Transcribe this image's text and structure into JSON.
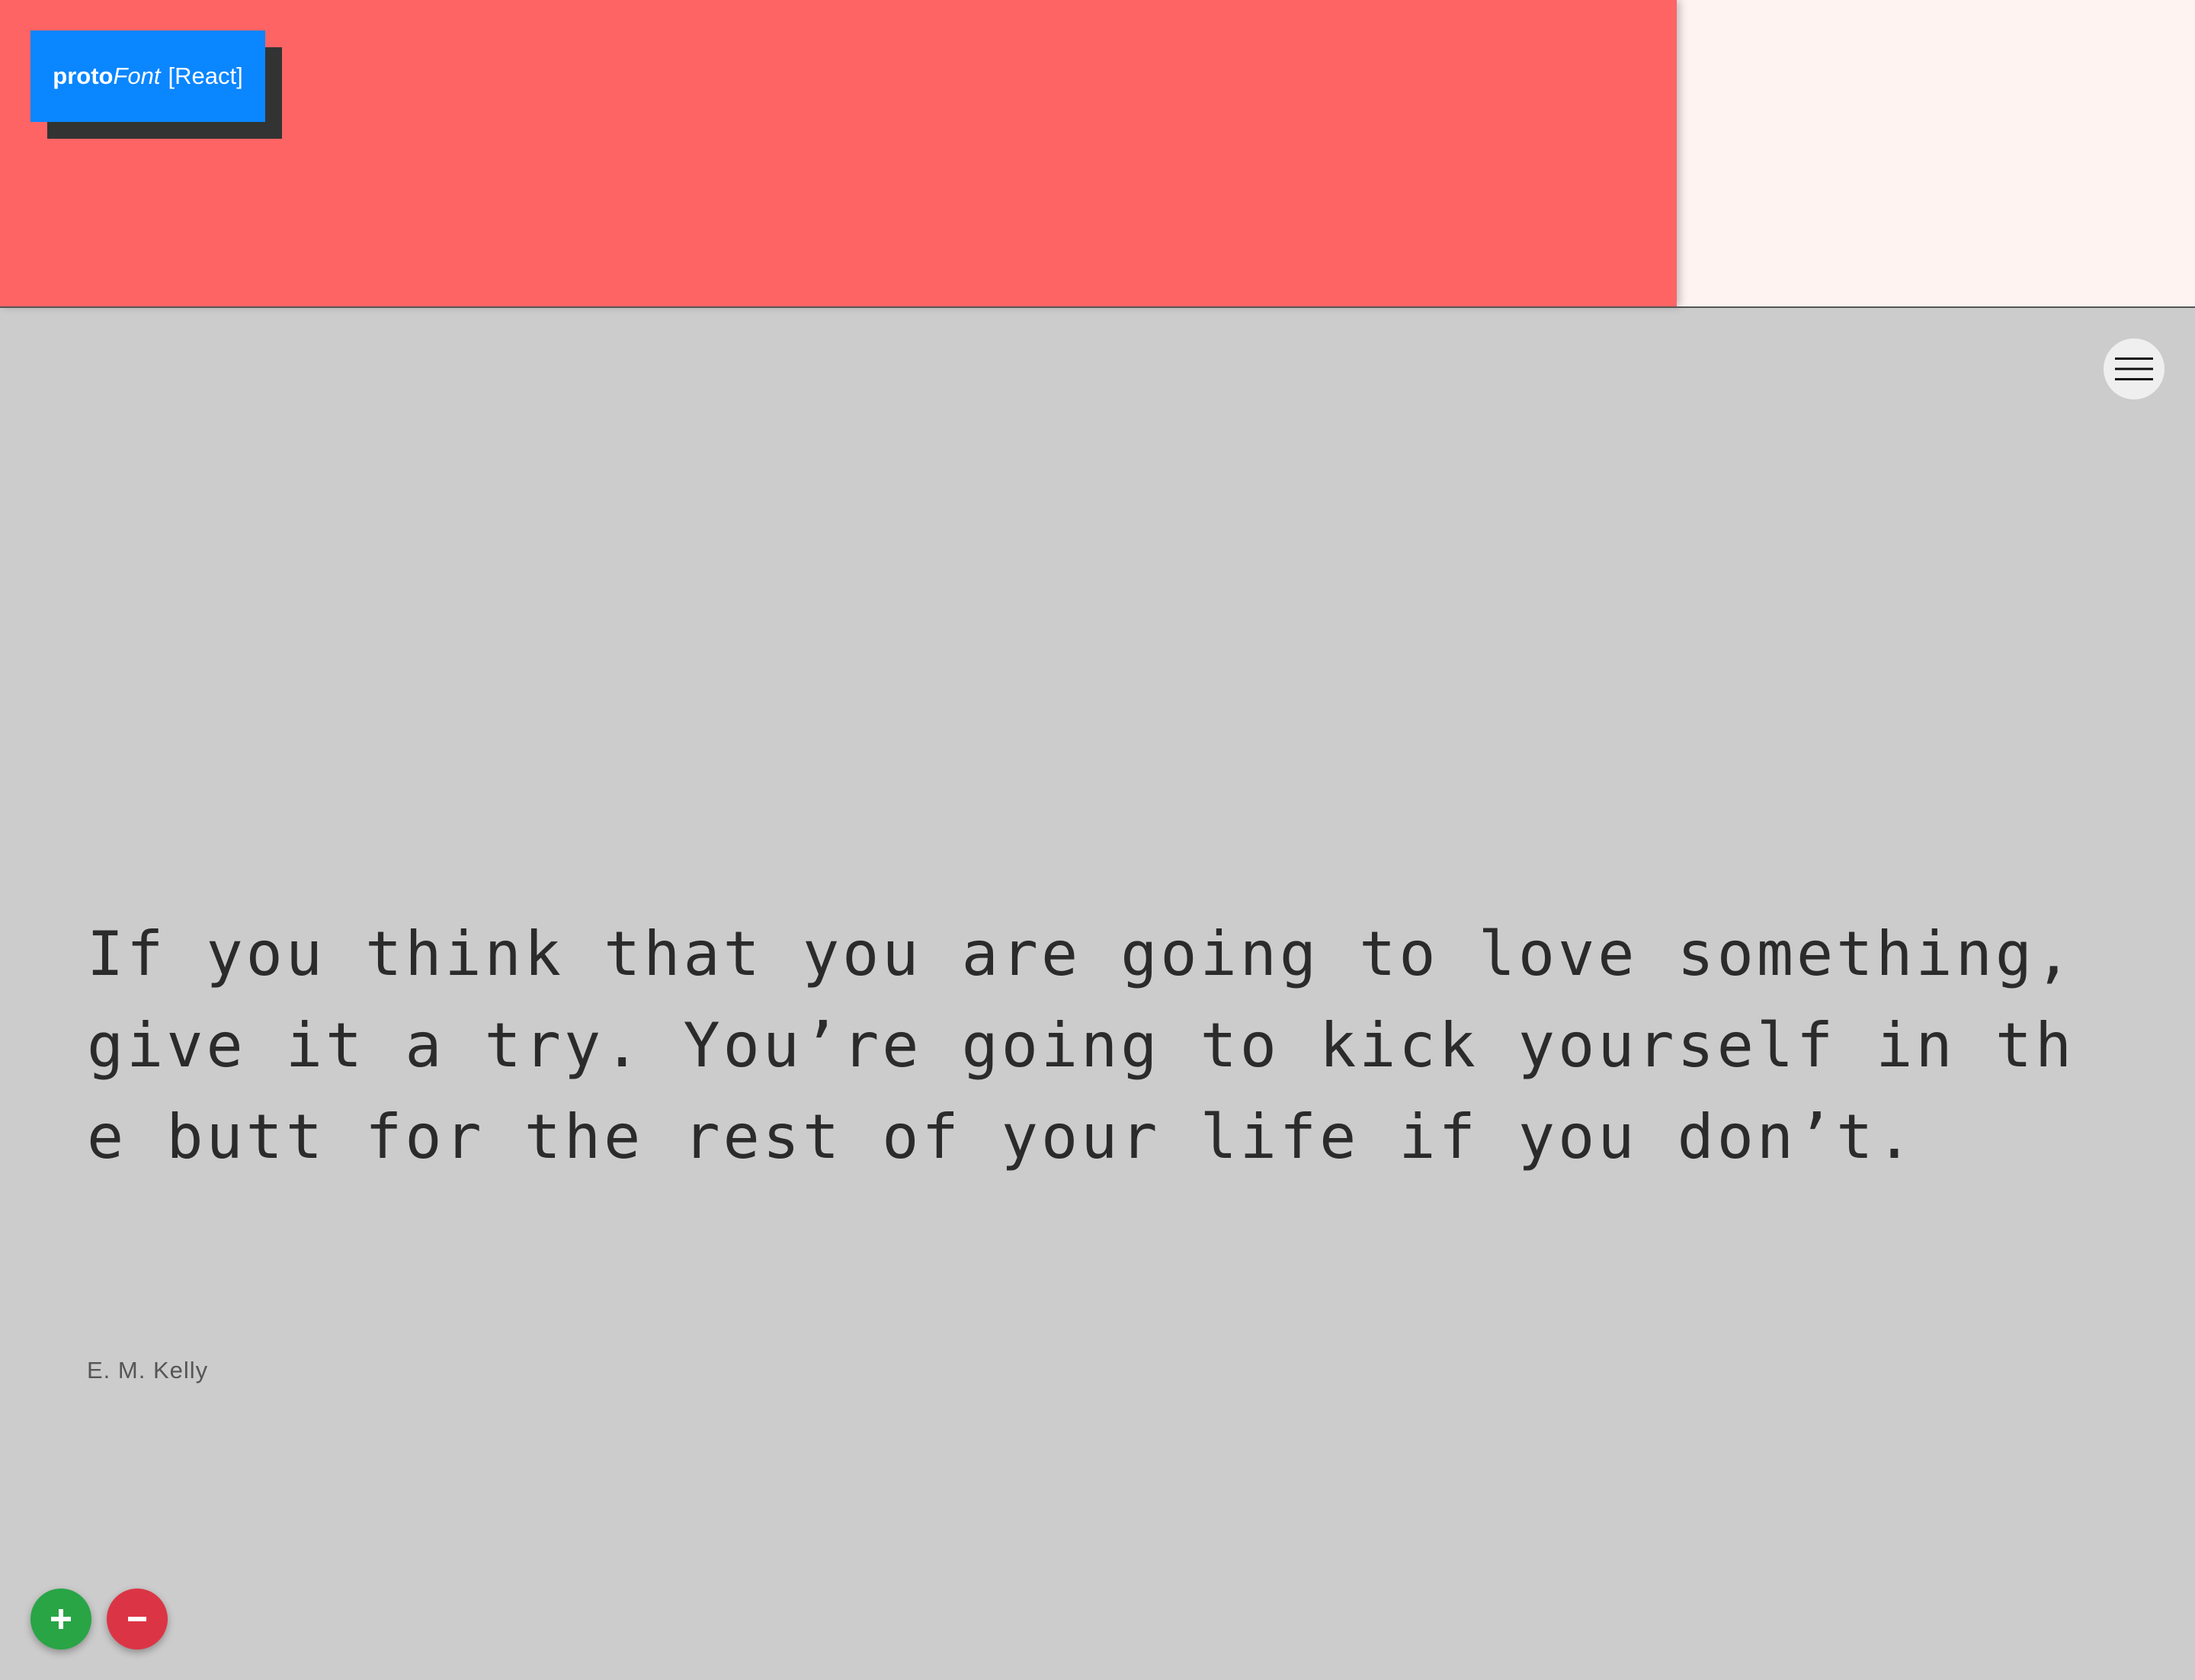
{
  "app": {
    "logo": {
      "proto": "proto",
      "font": "Font",
      "framework": "[React]"
    }
  },
  "header": {
    "left_color": "#ff6464",
    "right_color": "#fff3f2",
    "logo_color": "#0a86ff"
  },
  "menu": {
    "icon": "hamburger-menu-icon"
  },
  "quote": {
    "text": "If you think that you are going to love something, give it a try. You’re going to kick yourself in the butt for the rest of your life if you don’t.",
    "author": "E. M. Kelly"
  },
  "controls": {
    "increase_icon": "plus-icon",
    "decrease_icon": "minus-icon",
    "increase_color": "#29a545",
    "decrease_color": "#db3545"
  }
}
